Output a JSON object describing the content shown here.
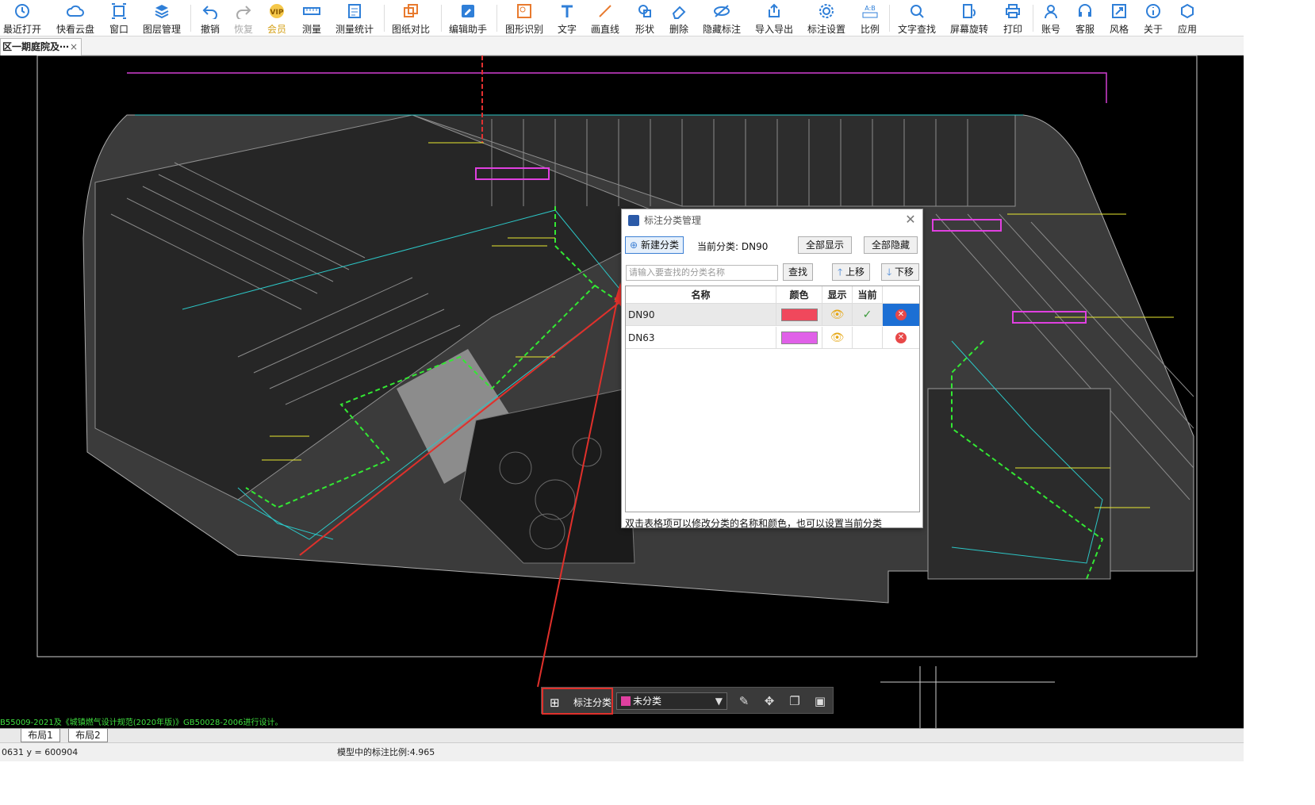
{
  "toolbar": {
    "items": [
      {
        "label": "最近打开",
        "icon": "recent-icon"
      },
      {
        "label": "快看云盘",
        "icon": "cloud-icon"
      },
      {
        "label": "窗口",
        "icon": "window-icon"
      },
      {
        "label": "图层管理",
        "icon": "layers-icon"
      },
      {
        "label": "撤销",
        "icon": "undo-icon"
      },
      {
        "label": "恢复",
        "icon": "redo-icon"
      },
      {
        "label": "会员",
        "icon": "vip-icon"
      },
      {
        "label": "测量",
        "icon": "measure-icon"
      },
      {
        "label": "测量统计",
        "icon": "measure-stats-icon"
      },
      {
        "label": "图纸对比",
        "icon": "compare-icon"
      },
      {
        "label": "编辑助手",
        "icon": "edit-assistant-icon"
      },
      {
        "label": "图形识别",
        "icon": "shape-recognition-icon"
      },
      {
        "label": "文字",
        "icon": "text-icon"
      },
      {
        "label": "画直线",
        "icon": "line-icon"
      },
      {
        "label": "形状",
        "icon": "shape-icon"
      },
      {
        "label": "删除",
        "icon": "eraser-icon"
      },
      {
        "label": "隐藏标注",
        "icon": "hide-annotation-icon"
      },
      {
        "label": "导入导出",
        "icon": "import-export-icon"
      },
      {
        "label": "标注设置",
        "icon": "annotation-settings-icon"
      },
      {
        "label": "比例",
        "icon": "scale-icon"
      },
      {
        "label": "文字查找",
        "icon": "text-search-icon"
      },
      {
        "label": "屏幕旋转",
        "icon": "rotate-icon"
      },
      {
        "label": "打印",
        "icon": "print-icon"
      },
      {
        "label": "账号",
        "icon": "account-icon"
      },
      {
        "label": "客服",
        "icon": "support-icon"
      },
      {
        "label": "风格",
        "icon": "style-icon"
      },
      {
        "label": "关于",
        "icon": "about-icon"
      },
      {
        "label": "应用",
        "icon": "apps-icon"
      }
    ]
  },
  "doc_tab": {
    "title": "区一期庭院及⋯",
    "close": "×"
  },
  "layout_tabs": [
    "布局1",
    "布局2"
  ],
  "status": {
    "coords": "0631 y = 600904",
    "scale_text": "模型中的标注比例:4.965"
  },
  "drawing_note": "B55009-2021及《城镇燃气设计规范(2020年版)》GB50028-2006进行设计。",
  "dialog": {
    "title": "标注分类管理",
    "new_category": "新建分类",
    "current_category": "当前分类: DN90",
    "show_all": "全部显示",
    "hide_all": "全部隐藏",
    "search_placeholder": "请输入要查找的分类名称",
    "search_btn": "查找",
    "move_up": "上移",
    "move_down": "下移",
    "columns": [
      "名称",
      "颜色",
      "显示",
      "当前"
    ],
    "rows": [
      {
        "name": "DN90",
        "color": "#f0485c",
        "visible": true,
        "current": true
      },
      {
        "name": "DN63",
        "color": "#e060e8",
        "visible": true,
        "current": false
      }
    ],
    "hint": "双击表格项可以修改分类的名称和颜色，也可以设置当前分类"
  },
  "floatbar": {
    "label": "标注分类",
    "selected": "未分类",
    "selected_color": "#e040a0"
  },
  "colors": {
    "accent": "#3c7fd4",
    "annotation_red": "#e0302b",
    "canvas_bg": "#000000"
  }
}
